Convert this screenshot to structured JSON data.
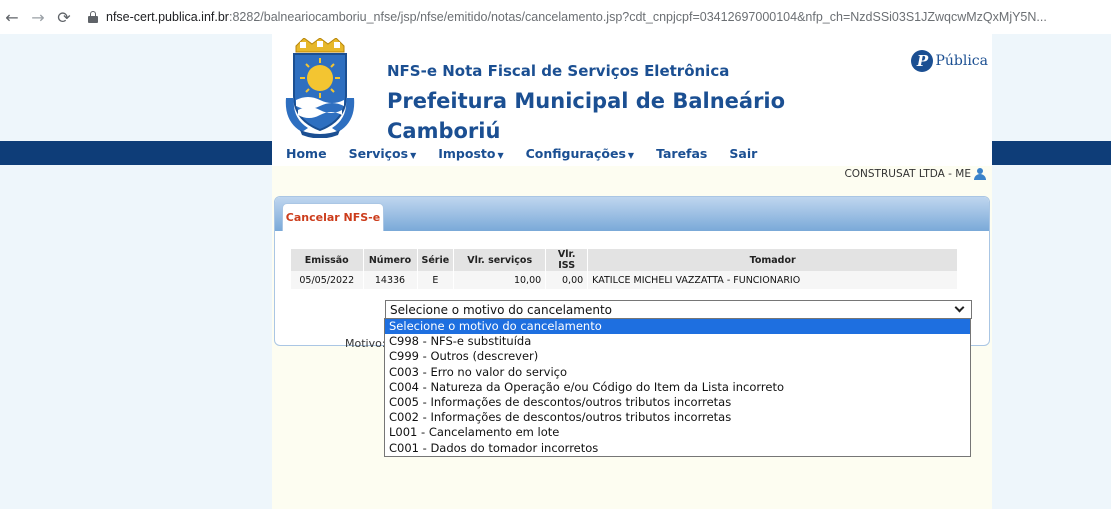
{
  "browser": {
    "url_host": "nfse-cert.publica.inf.br",
    "url_rest": ":8282/balneariocamboriu_nfse/jsp/nfse/emitido/notas/cancelamento.jsp?cdt_cnpjcpf=03412697000104&nfp_ch=NzdSSi03S1JZwqcwMzQxMjY5N..."
  },
  "header": {
    "subtitle": "NFS-e Nota Fiscal de Serviços Eletrônica",
    "title": "Prefeitura Municipal de Balneário Camboriú",
    "logo_mark": "P",
    "logo_text": "Pública"
  },
  "menu": {
    "home": "Home",
    "servicos": "Serviços",
    "imposto": "Imposto",
    "configuracoes": "Configurações",
    "tarefas": "Tarefas",
    "sair": "Sair"
  },
  "user": {
    "name": "CONSTRUSAT LTDA - ME"
  },
  "panel": {
    "tab_label": "Cancelar NFS-e"
  },
  "table": {
    "headers": [
      "Emissão",
      "Número",
      "Série",
      "Vlr. serviços",
      "Vlr. ISS",
      "Tomador"
    ],
    "row": [
      "05/05/2022",
      "14336",
      "E",
      "10,00",
      "0,00",
      "KATILCE MICHELI VAZZATTA - FUNCIONARIO"
    ]
  },
  "motivo": {
    "label": "Motivo:",
    "selected": "Selecione o motivo do cancelamento",
    "options": [
      "Selecione o motivo do cancelamento",
      "C998 - NFS-e substituída",
      "C999 - Outros (descrever)",
      "C003 - Erro no valor do serviço",
      "C004 - Natureza da Operação e/ou Código do Item da Lista incorreto",
      "C005 - Informações de descontos/outros tributos incorretas",
      "C002 - Informações de descontos/outros tributos incorretas",
      "L001 - Cancelamento em lote",
      "C001 - Dados do tomador incorretos"
    ]
  },
  "colors": {
    "brand_blue": "#1b4f92",
    "band_blue": "#0e3d78",
    "tab_red": "#cc3c1b",
    "selected_option": "#1e6fe0"
  }
}
